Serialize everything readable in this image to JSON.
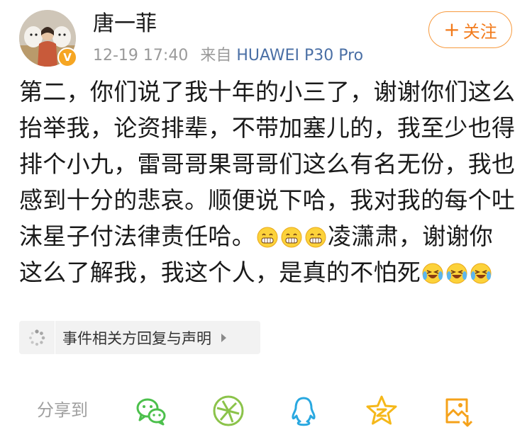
{
  "post": {
    "username": "唐一菲",
    "timestamp": "12-19 17:40",
    "source_prefix": "来自",
    "device": "HUAWEI P30 Pro",
    "follow_label": "关注",
    "verified_badge": "V",
    "text_segments": [
      "第二，你们说了我十年的小三了，谢谢你们这么抬举我，论资排辈，不带加塞儿的，我至少也得排个小九，雷哥哥果哥哥们这么有名无份，我也感到十分的悲哀。顺便说下哈，我对我的每个吐沫星子付法律责任哈。",
      "凌潇肃，谢谢你这么了解我，我这个人，是真的不怕死"
    ],
    "emojis_first": [
      "grin-emoji",
      "grin-emoji",
      "grin-emoji"
    ],
    "emojis_last": [
      "laugh-cry-emoji",
      "laugh-cry-emoji",
      "laugh-cry-emoji"
    ]
  },
  "event_tag": {
    "label": "事件相关方回复与声明",
    "icon": "loading-spinner-icon"
  },
  "share": {
    "label": "分享到",
    "targets": [
      "wechat-icon",
      "moments-icon",
      "qq-icon",
      "qzone-icon",
      "save-image-icon"
    ]
  },
  "colors": {
    "accent_orange": "#f27b1c",
    "device_blue": "#4a6fa5",
    "wechat_green": "#4cc04c",
    "moments_green": "#8bc34a",
    "qq_blue": "#29a8e0",
    "qzone_yellow": "#f5b81a",
    "save_orange": "#f5a21a"
  }
}
